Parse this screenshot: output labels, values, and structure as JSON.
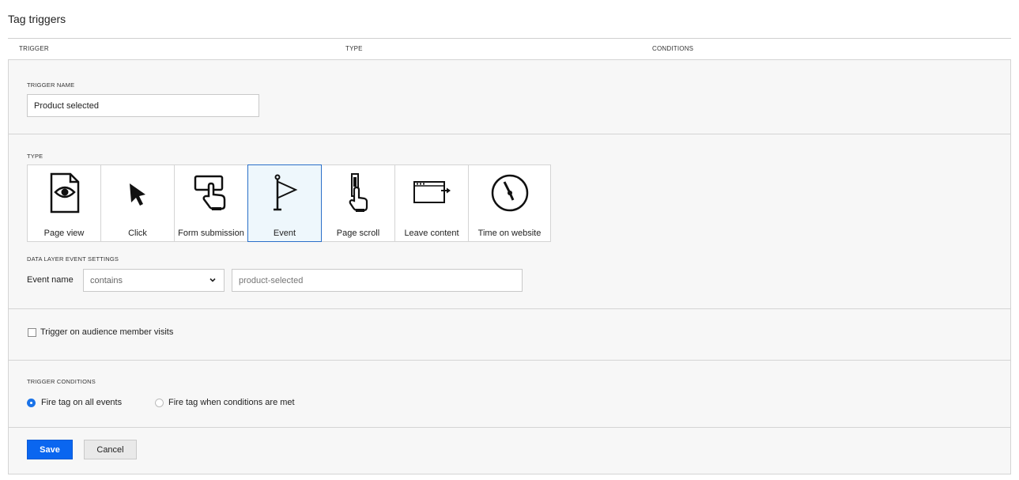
{
  "page": {
    "title": "Tag triggers"
  },
  "columns": [
    "TRIGGER",
    "TYPE",
    "CONDITIONS"
  ],
  "trigger_name": {
    "label": "TRIGGER NAME",
    "value": "Product selected"
  },
  "type_section": {
    "label": "TYPE",
    "selected": "Event",
    "items": [
      {
        "label": "Page view",
        "icon": "page-view-icon"
      },
      {
        "label": "Click",
        "icon": "cursor-icon"
      },
      {
        "label": "Form submission",
        "icon": "form-submission-icon"
      },
      {
        "label": "Event",
        "icon": "flag-icon"
      },
      {
        "label": "Page scroll",
        "icon": "page-scroll-icon"
      },
      {
        "label": "Leave content",
        "icon": "leave-content-icon"
      },
      {
        "label": "Time on website",
        "icon": "clock-icon"
      }
    ]
  },
  "data_layer": {
    "label": "DATA LAYER EVENT SETTINGS",
    "event_name_label": "Event name",
    "operator": "contains",
    "value_placeholder": "product-selected"
  },
  "audience": {
    "label": "Trigger on audience member visits",
    "checked": false
  },
  "conditions": {
    "label": "TRIGGER CONDITIONS",
    "options": [
      "Fire tag on all events",
      "Fire tag when conditions are met"
    ],
    "selected": "Fire tag on all events"
  },
  "actions": {
    "save": "Save",
    "cancel": "Cancel"
  },
  "colors": {
    "primary": "#0a66f0",
    "selected_card_border": "#2a6fc9",
    "selected_card_bg": "#eef7fc",
    "panel_bg": "#f7f7f7"
  }
}
